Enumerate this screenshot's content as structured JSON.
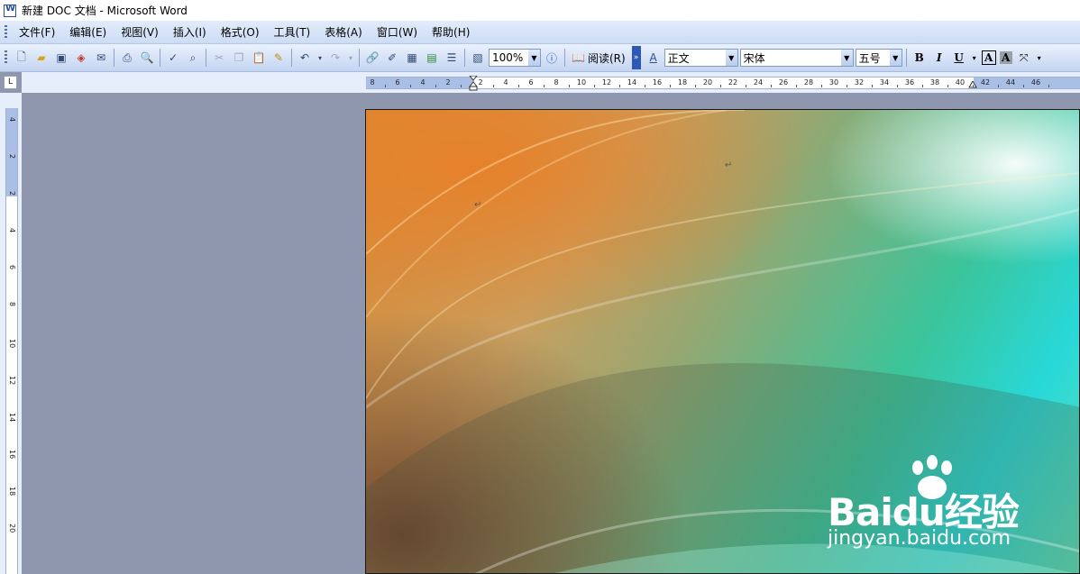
{
  "window": {
    "title": "新建 DOC 文档 - Microsoft Word"
  },
  "menu": {
    "items": [
      "文件(F)",
      "编辑(E)",
      "视图(V)",
      "插入(I)",
      "格式(O)",
      "工具(T)",
      "表格(A)",
      "窗口(W)",
      "帮助(H)"
    ]
  },
  "toolbar": {
    "zoom": "100%",
    "read_label": "阅读(R)",
    "style": "正文",
    "font": "宋体",
    "font_size": "五号",
    "bold": "B",
    "italic": "I",
    "underline": "U",
    "font_color_glyph": "A",
    "highlight_glyph": "A"
  },
  "ruler": {
    "corner": "L",
    "h_labels": [
      "8",
      "6",
      "4",
      "2",
      "2",
      "4",
      "6",
      "8",
      "10",
      "12",
      "14",
      "16",
      "18",
      "20",
      "22",
      "24",
      "26",
      "28",
      "30",
      "32",
      "34",
      "36",
      "38",
      "40",
      "42",
      "44",
      "46"
    ],
    "v_labels": [
      "4",
      "2",
      "2",
      "4",
      "6",
      "8",
      "10",
      "12",
      "14",
      "16",
      "18",
      "20"
    ]
  },
  "document": {
    "paragraph_mark": "↵"
  },
  "watermark": {
    "logo_text": "Baidu经验",
    "url": "jingyan.baidu.com"
  }
}
